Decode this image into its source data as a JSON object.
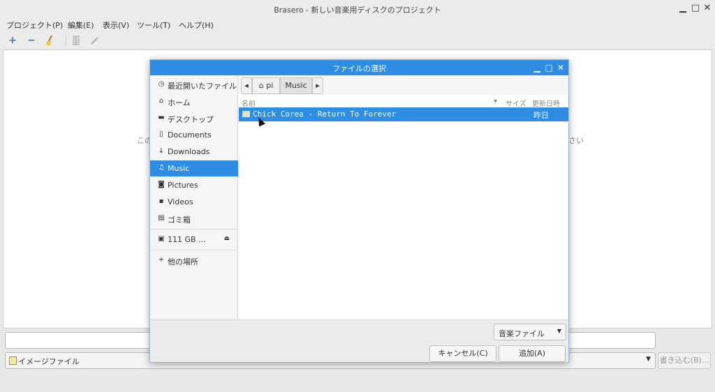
{
  "window": {
    "title": "Brasero - 新しい音楽用ディスクのプロジェクト",
    "controls": [
      "minimize-icon",
      "maximize-icon",
      "close-icon"
    ]
  },
  "menubar": {
    "items": [
      {
        "label": "プロジェクト(P)"
      },
      {
        "label": "編集(E)"
      },
      {
        "label": "表示(V)"
      },
      {
        "label": "ツール(T)"
      },
      {
        "label": "ヘルプ(H)"
      }
    ]
  },
  "toolbar": {
    "add": "+",
    "remove": "−",
    "icons": [
      "add-icon",
      "remove-icon",
      "clean-icon",
      "split-icon",
      "edit-icon"
    ]
  },
  "main": {
    "hint_left": "この",
    "hint_right": "さい",
    "image_combo": "イメージファイル",
    "burn_button": "書き込む(B)..."
  },
  "dialog": {
    "title": "ファイルの選択",
    "sidebar": [
      {
        "label": "最近開いたファイル",
        "icon": "clock-icon",
        "glyph": "◷"
      },
      {
        "label": "ホーム",
        "icon": "home-icon",
        "glyph": "⌂"
      },
      {
        "label": "デスクトップ",
        "icon": "folder-icon",
        "glyph": "▬"
      },
      {
        "label": "Documents",
        "icon": "document-icon",
        "glyph": "▯"
      },
      {
        "label": "Downloads",
        "icon": "download-icon",
        "glyph": "↓"
      },
      {
        "label": "Music",
        "icon": "music-icon",
        "glyph": "♫",
        "selected": true
      },
      {
        "label": "Pictures",
        "icon": "camera-icon",
        "glyph": "◙"
      },
      {
        "label": "Videos",
        "icon": "video-icon",
        "glyph": "▪"
      },
      {
        "label": "ゴミ箱",
        "icon": "trash-icon",
        "glyph": "▤"
      }
    ],
    "drive": {
      "label": "111 GB ...",
      "glyph": "▣",
      "eject": "⏏"
    },
    "other_locations": {
      "label": "他の場所",
      "glyph": "+"
    },
    "path": {
      "back": "◂",
      "home_label": "pi",
      "home_glyph": "⌂",
      "current": "Music",
      "forward": "▸"
    },
    "columns": {
      "name": "名前",
      "size": "サイズ",
      "modified": "更新日時",
      "sort_glyph": "▾"
    },
    "files": [
      {
        "name": "Chick Corea - Return To Forever",
        "modified": "昨日",
        "selected": true
      }
    ],
    "filter": "音楽ファイル",
    "cancel": "キャンセル(C)",
    "add": "追加(A)"
  },
  "colors": {
    "accent": "#2e8ce3"
  }
}
